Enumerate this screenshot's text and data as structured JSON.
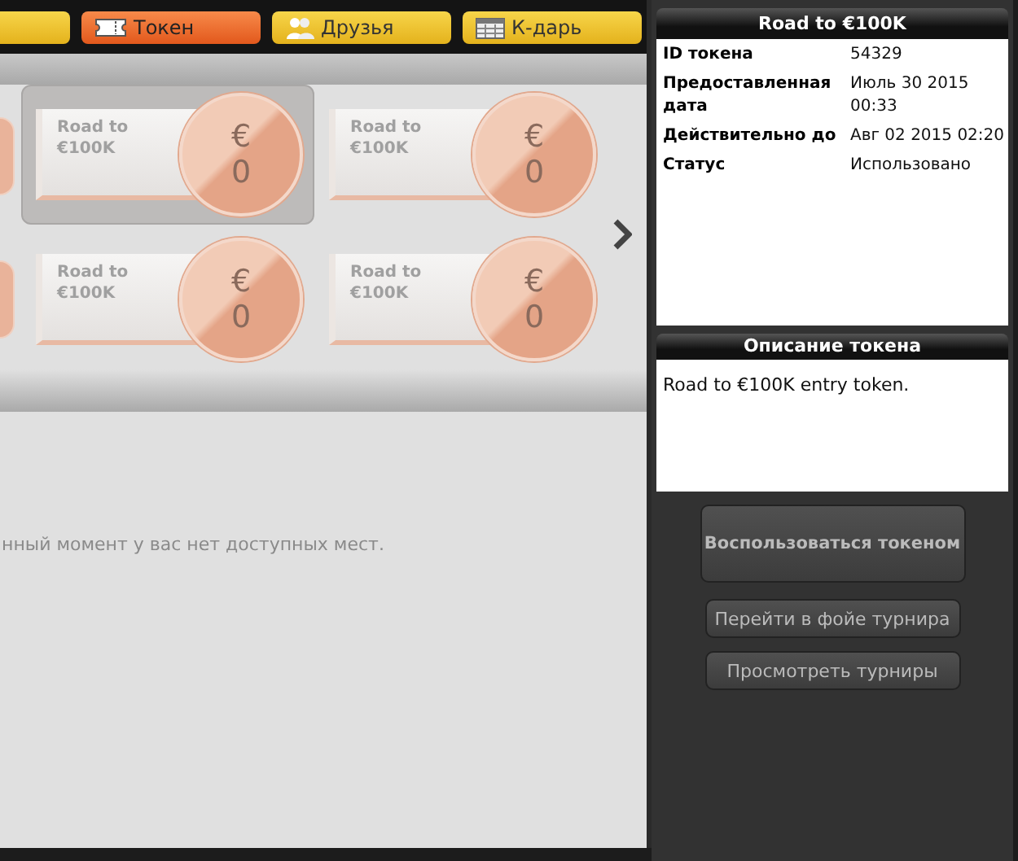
{
  "tabs": [
    {
      "selected": false
    },
    {
      "label": "Токен",
      "selected": true
    },
    {
      "label": "Друзья",
      "selected": false
    },
    {
      "label": "К-дарь",
      "selected": false
    }
  ],
  "tokens": [
    {
      "name": "Road to €100K",
      "currency": "€",
      "amount": "0",
      "selected": true
    },
    {
      "name": "Road to €100K",
      "currency": "€",
      "amount": "0",
      "selected": false
    },
    {
      "name": "Road to €100K",
      "currency": "€",
      "amount": "0",
      "selected": false
    },
    {
      "name": "Road to €100K",
      "currency": "€",
      "amount": "0",
      "selected": false
    }
  ],
  "message": "нный момент у вас нет доступных мест.",
  "details": {
    "title": "Road to €100K",
    "rows": [
      {
        "label": "ID токена",
        "value": "54329"
      },
      {
        "label": "Предоставленная дата",
        "value": "Июль 30 2015 00:33"
      },
      {
        "label": "Действительно до",
        "value": "Авг 02 2015 02:20"
      },
      {
        "label": "Статус",
        "value": "Использовано"
      }
    ]
  },
  "description": {
    "title": "Описание токена",
    "text": "Road to €100K entry token."
  },
  "buttons": [
    {
      "label": "Воспользоваться токеном",
      "kind": "primary"
    },
    {
      "label": "Перейти в фойе турнира",
      "kind": "secondary"
    },
    {
      "label": "Просмотреть турниры",
      "kind": "secondary"
    }
  ]
}
